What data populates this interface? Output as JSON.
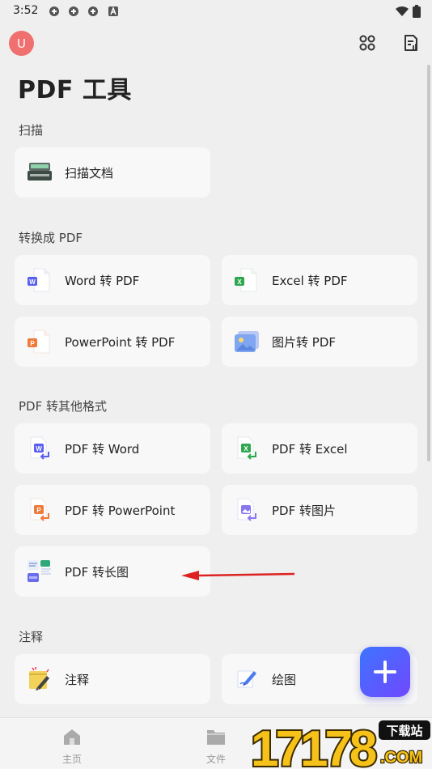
{
  "status_bar": {
    "time": "3:52"
  },
  "header": {
    "avatar_letter": "U",
    "title": "PDF 工具"
  },
  "sections": {
    "scan": {
      "title": "扫描",
      "items": [
        {
          "label": "扫描文档",
          "icon": "scanner-icon"
        }
      ]
    },
    "to_pdf": {
      "title": "转换成 PDF",
      "items": [
        {
          "label": "Word 转 PDF",
          "icon": "word-doc-icon"
        },
        {
          "label": "Excel 转 PDF",
          "icon": "excel-doc-icon"
        },
        {
          "label": "PowerPoint 转 PDF",
          "icon": "powerpoint-doc-icon"
        },
        {
          "label": "图片转 PDF",
          "icon": "image-icon"
        }
      ]
    },
    "from_pdf": {
      "title": "PDF 转其他格式",
      "items": [
        {
          "label": "PDF 转 Word",
          "icon": "pdf-to-word-icon"
        },
        {
          "label": "PDF 转 Excel",
          "icon": "pdf-to-excel-icon"
        },
        {
          "label": "PDF 转 PowerPoint",
          "icon": "pdf-to-powerpoint-icon"
        },
        {
          "label": "PDF 转图片",
          "icon": "pdf-to-image-icon"
        },
        {
          "label": "PDF 转长图",
          "icon": "pdf-to-long-image-icon"
        }
      ]
    },
    "annotate": {
      "title": "注释",
      "items": [
        {
          "label": "注释",
          "icon": "sticky-note-icon"
        },
        {
          "label": "绘图",
          "icon": "drawing-pen-icon"
        }
      ]
    }
  },
  "bottom_nav": {
    "home": "主页",
    "files": "文件"
  },
  "watermark": {
    "number": "17178",
    "badge": "下载站",
    "domain": ".COM"
  },
  "colors": {
    "word": "#5a5ff0",
    "excel": "#2ea84f",
    "powerpoint": "#f07a3a",
    "fab": "#5a5fff",
    "avatar": "#f06f6f"
  }
}
